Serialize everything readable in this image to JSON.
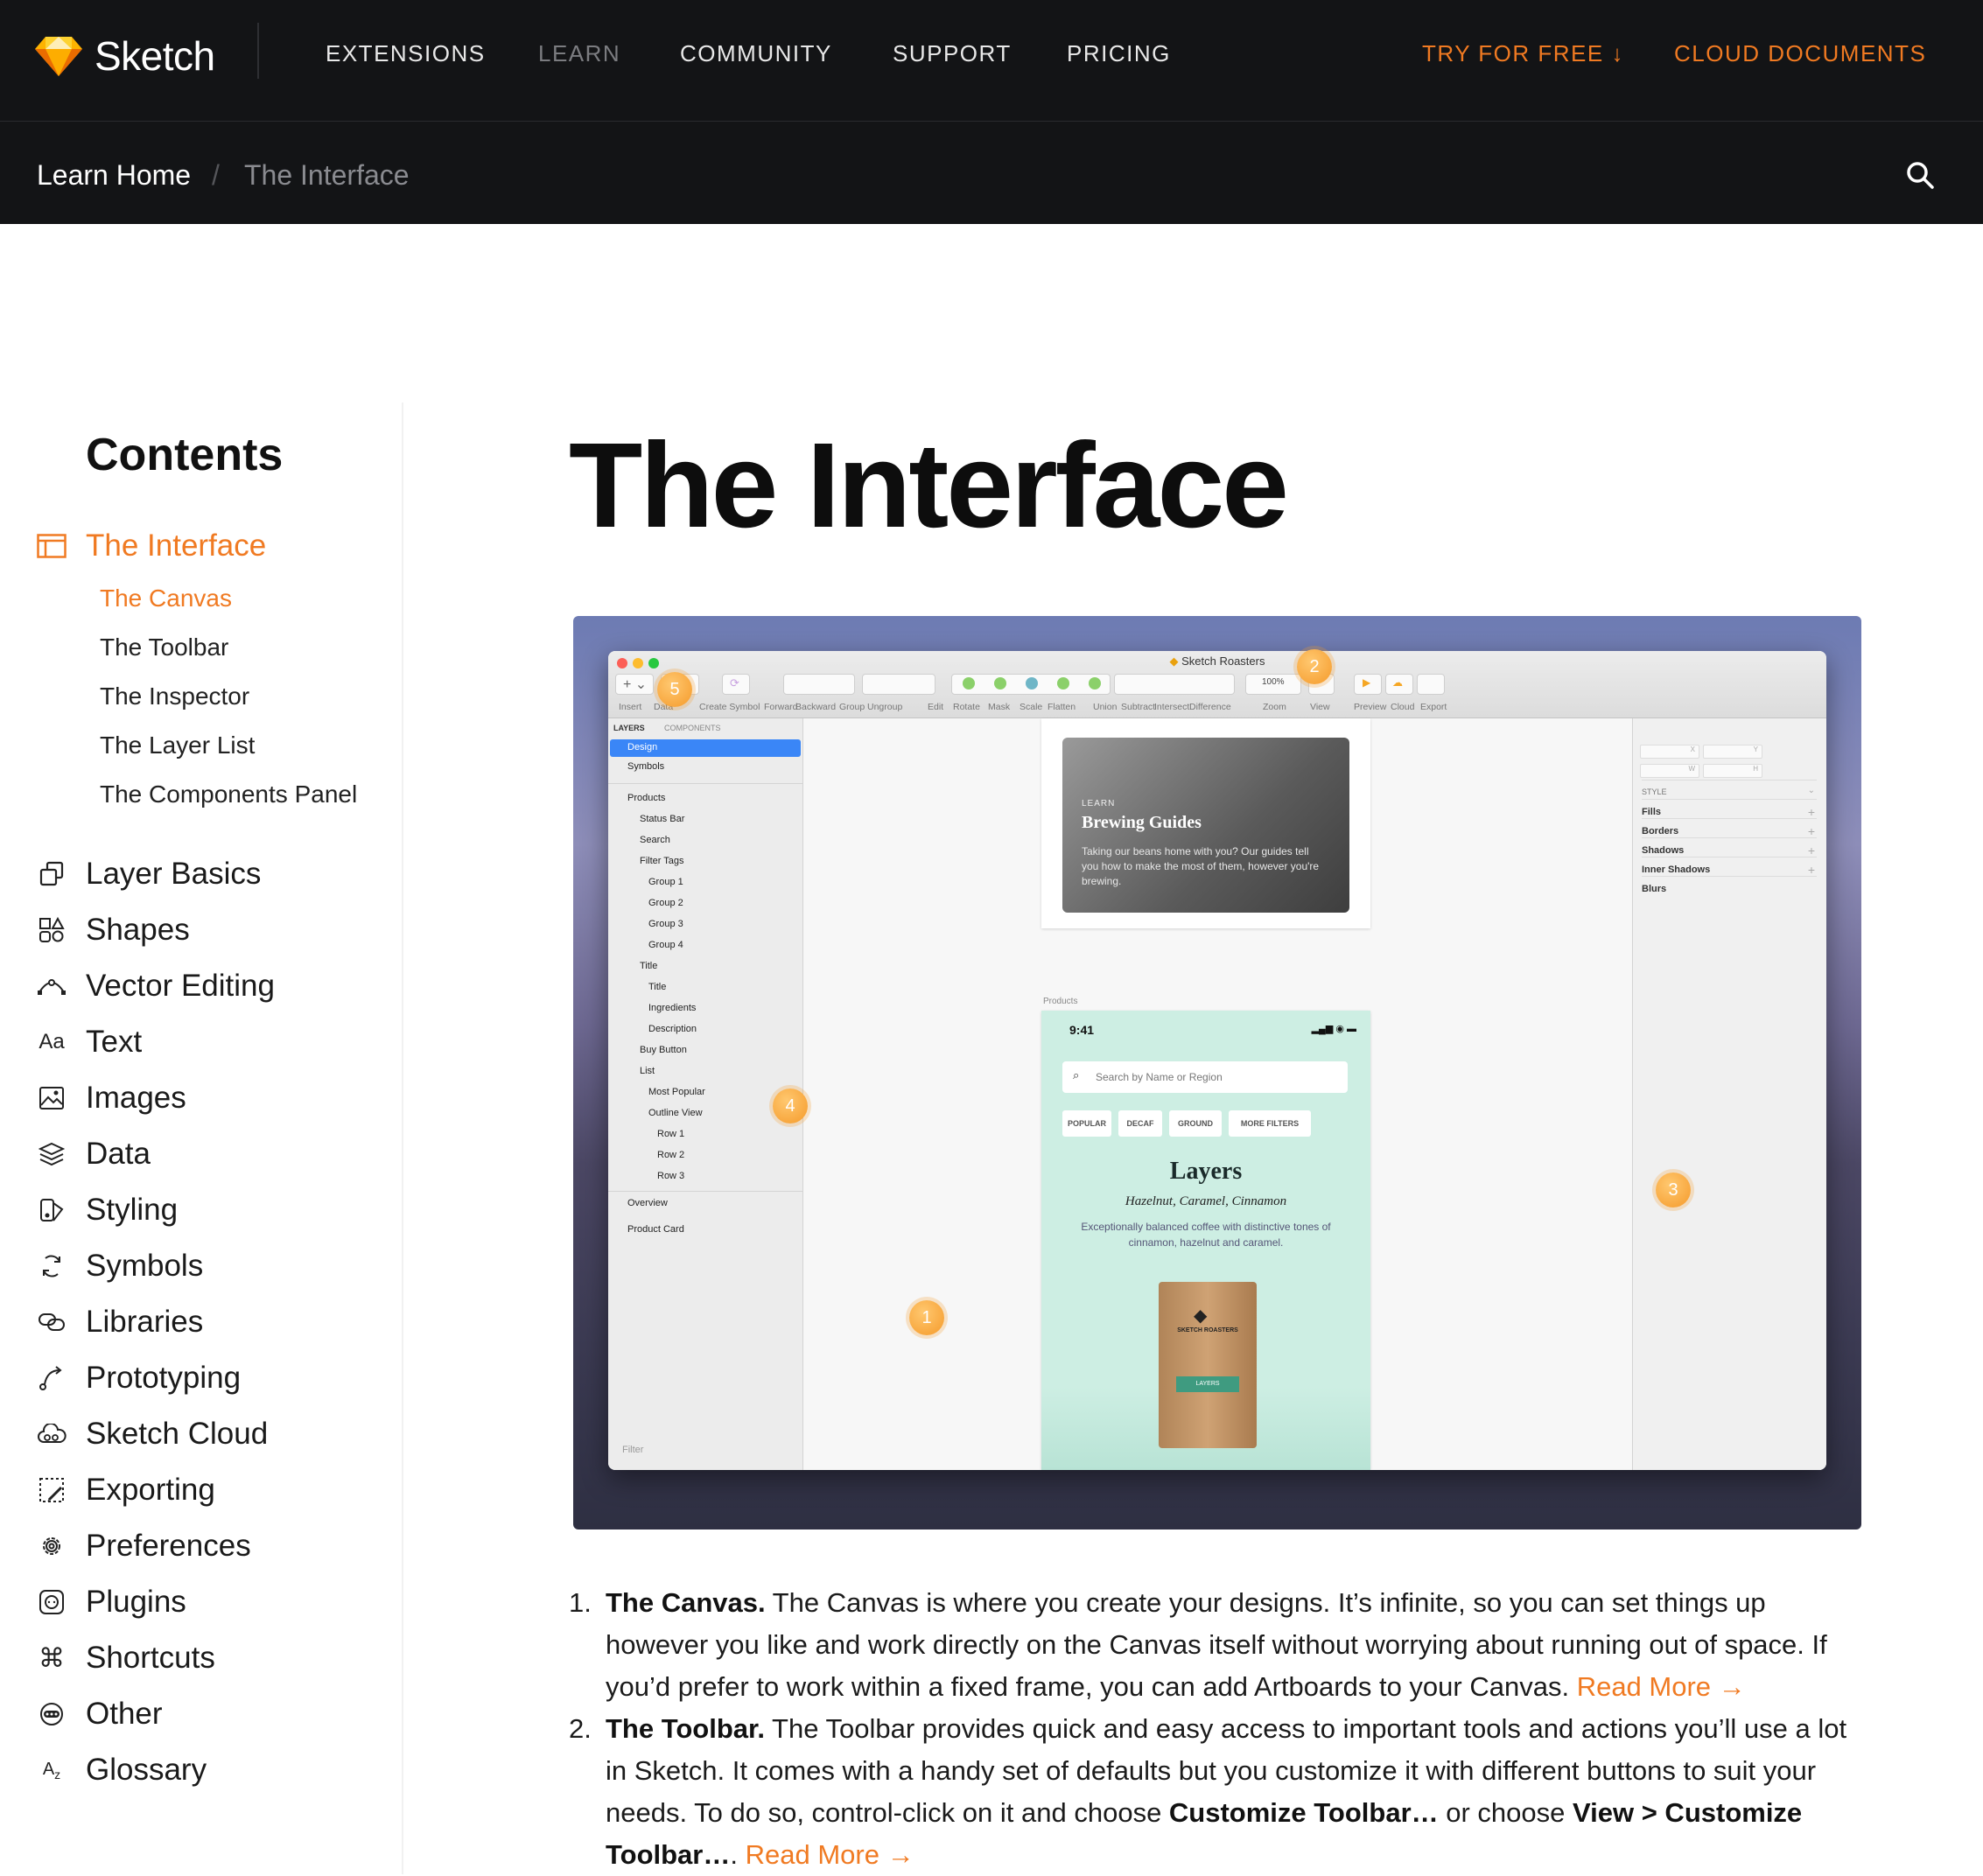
{
  "brand": {
    "name": "Sketch",
    "accent": "#f07a22"
  },
  "nav": {
    "items": [
      {
        "label": "EXTENSIONS",
        "state": "normal"
      },
      {
        "label": "LEARN",
        "state": "active"
      },
      {
        "label": "COMMUNITY",
        "state": "normal"
      },
      {
        "label": "SUPPORT",
        "state": "normal"
      },
      {
        "label": "PRICING",
        "state": "normal"
      }
    ],
    "try_free": "TRY FOR FREE ↓",
    "cloud_docs": "CLOUD DOCUMENTS"
  },
  "breadcrumb": {
    "home": "Learn Home",
    "separator": "/",
    "current": "The Interface"
  },
  "sidebar": {
    "title": "Contents",
    "active": {
      "label": "The Interface",
      "icon": "interface-icon"
    },
    "subitems": [
      {
        "label": "The Canvas",
        "active": true
      },
      {
        "label": "The Toolbar",
        "active": false
      },
      {
        "label": "The Inspector",
        "active": false
      },
      {
        "label": "The Layer List",
        "active": false
      },
      {
        "label": "The Components Panel",
        "active": false
      }
    ],
    "items": [
      {
        "label": "Layer Basics",
        "icon": "layers-copy-icon"
      },
      {
        "label": "Shapes",
        "icon": "shapes-icon"
      },
      {
        "label": "Vector Editing",
        "icon": "vector-icon"
      },
      {
        "label": "Text",
        "icon": "text-icon"
      },
      {
        "label": "Images",
        "icon": "image-icon"
      },
      {
        "label": "Data",
        "icon": "data-stack-icon"
      },
      {
        "label": "Styling",
        "icon": "styling-icon"
      },
      {
        "label": "Symbols",
        "icon": "symbols-icon"
      },
      {
        "label": "Libraries",
        "icon": "libraries-icon"
      },
      {
        "label": "Prototyping",
        "icon": "prototyping-icon"
      },
      {
        "label": "Sketch Cloud",
        "icon": "cloud-icon"
      },
      {
        "label": "Exporting",
        "icon": "export-icon"
      },
      {
        "label": "Preferences",
        "icon": "gear-icon"
      },
      {
        "label": "Plugins",
        "icon": "plugin-icon"
      },
      {
        "label": "Shortcuts",
        "icon": "command-icon"
      },
      {
        "label": "Other",
        "icon": "other-icon"
      },
      {
        "label": "Glossary",
        "icon": "glossary-icon"
      }
    ]
  },
  "main": {
    "title": "The Interface",
    "screenshot": {
      "window_title": "Sketch Roasters",
      "toolbar": [
        "Insert",
        "Data",
        "Create Symbol",
        "Forward",
        "Backward",
        "Group",
        "Ungroup",
        "Edit",
        "Rotate",
        "Mask",
        "Scale",
        "Flatten",
        "Union",
        "Subtract",
        "Intersect",
        "Difference",
        "Zoom",
        "View",
        "Preview",
        "Cloud",
        "Export"
      ],
      "zoom_value": "100%",
      "layer_tabs": [
        "LAYERS",
        "COMPONENTS"
      ],
      "pages": [
        "Design",
        "Symbols"
      ],
      "layers": [
        "Products",
        "Status Bar",
        "Search",
        "Filter Tags",
        "Group 1",
        "Group 2",
        "Group 3",
        "Group 4",
        "Title",
        "Title",
        "Ingredients",
        "Description",
        "Buy Button",
        "List",
        "Most Popular",
        "Outline View",
        "Row 1",
        "Row 2",
        "Row 3",
        "Overview",
        "Product Card"
      ],
      "filter_placeholder": "Filter",
      "inspector": {
        "style": "STYLE",
        "rows": [
          "Fills",
          "Borders",
          "Shadows",
          "Inner Shadows",
          "Blurs"
        ],
        "fields": [
          "X",
          "Y",
          "W",
          "H"
        ]
      },
      "card": {
        "eyebrow": "LEARN",
        "title": "Brewing Guides",
        "text": "Taking our beans home with you? Our guides tell you how to make the most of them, however you're brewing."
      },
      "artboard_label": "Products",
      "phone": {
        "time": "9:41",
        "search_placeholder": "Search by Name or Region",
        "chips": [
          "POPULAR",
          "DECAF",
          "GROUND",
          "MORE FILTERS"
        ],
        "heading": "Layers",
        "subheading": "Hazelnut, Caramel, Cinnamon",
        "description": "Exceptionally balanced coffee with distinctive tones of cinnamon, hazelnut and caramel.",
        "bag_label": "LAYERS",
        "bag_brand": "SKETCH ROASTERS"
      },
      "markers": [
        "1",
        "2",
        "3",
        "4",
        "5"
      ]
    },
    "list": [
      {
        "num": "1.",
        "term": "The Canvas.",
        "text": " The Canvas is where you create your designs. It’s infinite, so you can set things up however you like and work directly on the Canvas itself without worrying about running out of space. If you’d prefer to work within a fixed frame, you can add Artboards to your Canvas. ",
        "link": "Read More →"
      },
      {
        "num": "2.",
        "term": "The Toolbar.",
        "text": " The Toolbar provides quick and easy access to important tools and actions you’ll use a lot in Sketch. It comes with a handy set of defaults but you customize it with different buttons to suit your needs. To do so, control-click on it and choose ",
        "bold1": "Customize Toolbar…",
        "text2": " or choose ",
        "bold2": "View > Customize Toolbar…",
        "text3": ". ",
        "link": "Read More →"
      }
    ]
  }
}
